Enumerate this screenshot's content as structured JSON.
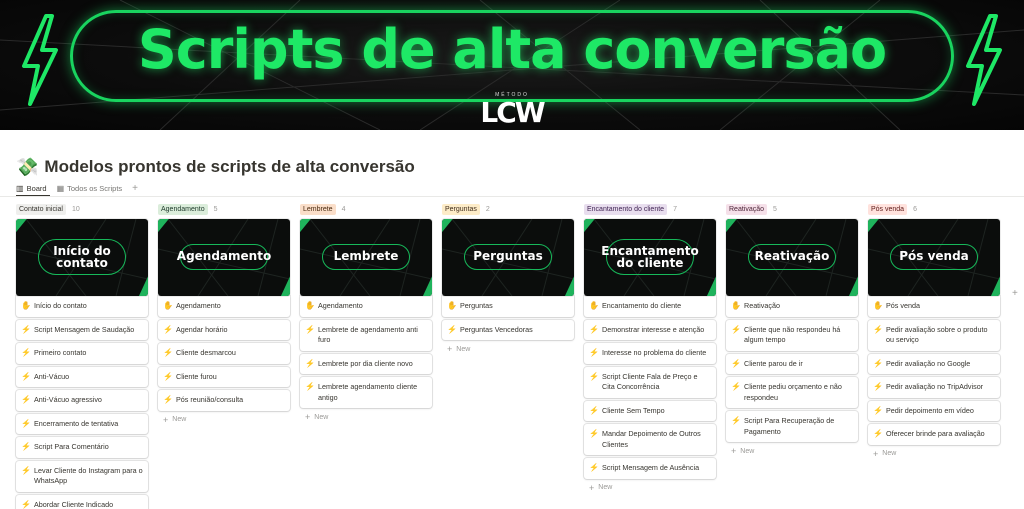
{
  "banner": {
    "title": "Scripts de alta conversão",
    "logo_sub": "MÉTODO",
    "logo_main": "LCW",
    "accent": "#1ee866"
  },
  "page": {
    "emoji": "💸",
    "title": "Modelos prontos de scripts de alta conversão"
  },
  "views": {
    "tabs": [
      {
        "icon": "board-icon",
        "glyph": "▥",
        "label": "Board"
      },
      {
        "icon": "table-icon",
        "glyph": "▦",
        "label": "Todos os Scripts"
      }
    ],
    "add_glyph": "+"
  },
  "new_label": "New",
  "columns": [
    {
      "tag": "Contato inicial",
      "count": "10",
      "tag_bg": "#efefed",
      "tag_fg": "#37352f",
      "cover": [
        "Início do",
        "contato"
      ],
      "cards": [
        {
          "icon": "hand",
          "label": "Início do contato"
        },
        {
          "icon": "bolt",
          "label": "Script Mensagem de Saudação"
        },
        {
          "icon": "bolt",
          "label": "Primeiro contato"
        },
        {
          "icon": "bolt",
          "label": "Anti-Vácuo"
        },
        {
          "icon": "bolt",
          "label": "Anti-Vácuo agressivo"
        },
        {
          "icon": "bolt",
          "label": "Encerramento de tentativa"
        },
        {
          "icon": "bolt",
          "label": "Script Para Comentário"
        },
        {
          "icon": "bolt",
          "label": "Levar Cliente do Instagram para o WhatsApp"
        },
        {
          "icon": "bolt",
          "label": "Abordar Cliente Indicado"
        }
      ],
      "show_new": false
    },
    {
      "tag": "Agendamento",
      "count": "5",
      "tag_bg": "#dbeddb",
      "tag_fg": "#1c3829",
      "cover": [
        "Agendamento"
      ],
      "cards": [
        {
          "icon": "hand",
          "label": "Agendamento"
        },
        {
          "icon": "bolt",
          "label": "Agendar horário"
        },
        {
          "icon": "bolt",
          "label": "Cliente desmarcou"
        },
        {
          "icon": "bolt",
          "label": "Cliente furou"
        },
        {
          "icon": "bolt",
          "label": "Pós reunião/consulta"
        }
      ],
      "show_new": true
    },
    {
      "tag": "Lembrete",
      "count": "4",
      "tag_bg": "#fadec9",
      "tag_fg": "#49290e",
      "cover": [
        "Lembrete"
      ],
      "cards": [
        {
          "icon": "hand",
          "label": "Agendamento"
        },
        {
          "icon": "bolt",
          "label": "Lembrete de agendamento anti furo"
        },
        {
          "icon": "bolt",
          "label": "Lembrete por dia cliente novo"
        },
        {
          "icon": "bolt",
          "label": "Lembrete agendamento cliente antigo"
        }
      ],
      "show_new": true
    },
    {
      "tag": "Perguntas",
      "count": "2",
      "tag_bg": "#fdecc8",
      "tag_fg": "#402c1b",
      "cover": [
        "Perguntas"
      ],
      "cards": [
        {
          "icon": "hand",
          "label": "Perguntas"
        },
        {
          "icon": "bolt",
          "label": "Perguntas Vencedoras"
        }
      ],
      "show_new": true
    },
    {
      "tag": "Encantamento do cliente",
      "count": "7",
      "tag_bg": "#e8deee",
      "tag_fg": "#412454",
      "cover": [
        "Encantamento",
        "do cliente"
      ],
      "cards": [
        {
          "icon": "hand",
          "label": "Encantamento do cliente"
        },
        {
          "icon": "bolt",
          "label": "Demonstrar interesse e atenção"
        },
        {
          "icon": "bolt",
          "label": "Interesse no problema do cliente"
        },
        {
          "icon": "bolt",
          "label": "Script Cliente Fala de Preço e Cita Concorrência"
        },
        {
          "icon": "bolt",
          "label": "Cliente Sem Tempo"
        },
        {
          "icon": "bolt",
          "label": "Mandar Depoimento de Outros Clientes"
        },
        {
          "icon": "bolt",
          "label": "Script Mensagem de Ausência"
        }
      ],
      "show_new": true
    },
    {
      "tag": "Reativação",
      "count": "5",
      "tag_bg": "#f5e0e9",
      "tag_fg": "#4c2337",
      "cover": [
        "Reativação"
      ],
      "cards": [
        {
          "icon": "hand",
          "label": "Reativação"
        },
        {
          "icon": "bolt",
          "label": "Cliente que não respondeu há algum tempo"
        },
        {
          "icon": "bolt",
          "label": "Cliente parou de ir"
        },
        {
          "icon": "bolt",
          "label": "Cliente pediu orçamento e não respondeu"
        },
        {
          "icon": "bolt",
          "label": "Script Para Recuperação de Pagamento"
        }
      ],
      "show_new": true
    },
    {
      "tag": "Pós venda",
      "count": "6",
      "tag_bg": "#ffe2dd",
      "tag_fg": "#5d1715",
      "cover": [
        "Pós venda"
      ],
      "cards": [
        {
          "icon": "hand",
          "label": "Pós venda"
        },
        {
          "icon": "bolt",
          "label": "Pedir avaliação sobre o produto ou serviço"
        },
        {
          "icon": "bolt",
          "label": "Pedir avaliação no Google"
        },
        {
          "icon": "bolt",
          "label": "Pedir avaliação no TripAdvisor"
        },
        {
          "icon": "bolt",
          "label": "Pedir depoimento em vídeo"
        },
        {
          "icon": "bolt",
          "label": "Oferecer brinde para avaliação"
        }
      ],
      "show_new": true
    }
  ],
  "board_add_glyph": "+"
}
